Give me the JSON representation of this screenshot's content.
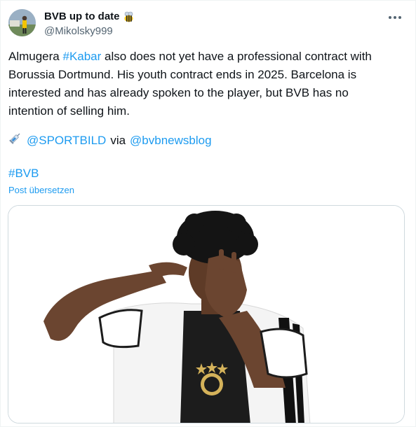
{
  "author": {
    "display_name": "BVB up to date",
    "handle": "@Mikolsky999",
    "badge_icon": "bee-emoji-icon",
    "avatar_icon": "avatar-photo"
  },
  "more_icon": "more-horizontal-icon",
  "tweet": {
    "lines": [
      {
        "pre": "Almugera ",
        "link": "#Kabar",
        "post": " also does not yet have a professional contract with"
      },
      {
        "pre": "Borussia Dortmund. His youth contract ends in 2025. Barcelona is",
        "link": "",
        "post": ""
      },
      {
        "pre": "interested and has already spoken to the player, but BVB has no",
        "link": "",
        "post": ""
      },
      {
        "pre": "intention of selling him.",
        "link": "",
        "post": ""
      }
    ],
    "source_icon": "syringe-emoji-icon",
    "source_mention": "@SPORTBILD",
    "via_text": "via",
    "via_mention": "@bvbnewsblog",
    "hashtag": "#BVB"
  },
  "translate_label": "Post übersetzen",
  "media": {
    "description_icon": "football-player-photo"
  },
  "colors": {
    "link": "#1d9bf0",
    "text": "#0f1419",
    "secondary": "#536471",
    "border": "#cfd9de"
  }
}
